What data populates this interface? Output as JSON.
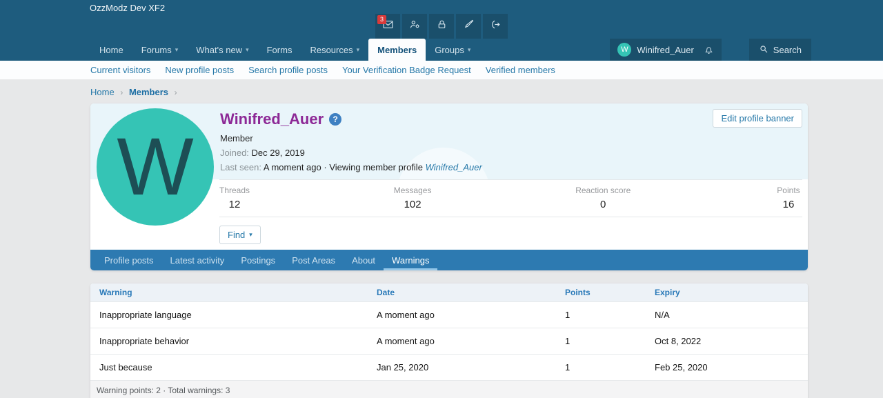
{
  "header": {
    "site_title": "OzzModz Dev XF2",
    "inbox_badge": "3",
    "nav": [
      {
        "label": "Home"
      },
      {
        "label": "Forums"
      },
      {
        "label": "What's new"
      },
      {
        "label": "Forms"
      },
      {
        "label": "Resources"
      },
      {
        "label": "Members"
      },
      {
        "label": "Groups"
      }
    ],
    "user": {
      "name": "Winifred_Auer",
      "avatar_letter": "W"
    },
    "search_label": "Search"
  },
  "subnav": [
    "Current visitors",
    "New profile posts",
    "Search profile posts",
    "Your Verification Badge Request",
    "Verified members"
  ],
  "breadcrumb": [
    "Home",
    "Members"
  ],
  "profile": {
    "username": "Winifred_Auer",
    "help_glyph": "?",
    "user_title": "Member",
    "joined_label": "Joined:",
    "joined_value": "Dec 29, 2019",
    "last_seen_label": "Last seen:",
    "last_seen_value": "A moment ago",
    "last_seen_separator": "·",
    "last_seen_activity": "Viewing member profile",
    "last_seen_link": "Winifred_Auer",
    "avatar_letter": "W",
    "edit_banner_label": "Edit profile banner",
    "find_label": "Find",
    "stats": [
      {
        "label": "Threads",
        "value": "12"
      },
      {
        "label": "Messages",
        "value": "102"
      },
      {
        "label": "Reaction score",
        "value": "0"
      },
      {
        "label": "Points",
        "value": "16"
      }
    ],
    "tabs": [
      {
        "label": "Profile posts"
      },
      {
        "label": "Latest activity"
      },
      {
        "label": "Postings"
      },
      {
        "label": "Post Areas"
      },
      {
        "label": "About"
      },
      {
        "label": "Warnings"
      }
    ]
  },
  "warnings_table": {
    "columns": [
      "Warning",
      "Date",
      "Points",
      "Expiry"
    ],
    "rows": [
      [
        "Inappropriate language",
        "A moment ago",
        "1",
        "N/A"
      ],
      [
        "Inappropriate behavior",
        "A moment ago",
        "1",
        "Oct 8, 2022"
      ],
      [
        "Just because",
        "Jan 25, 2020",
        "1",
        "Feb 25, 2020"
      ]
    ],
    "footer": "Warning points: 2 · Total warnings: 3"
  },
  "colors": {
    "header_bg": "#1e5c7e",
    "header_chip_bg": "#1a4f6b",
    "accent_link": "#2578a8",
    "username_purple": "#8d2996",
    "avatar_teal": "#35c4b5",
    "badge_red": "#d93a3a",
    "tabbar_bg": "#2d7ab1",
    "banner_bg": "#e9f5fa",
    "page_bg": "#e7e8e9"
  }
}
